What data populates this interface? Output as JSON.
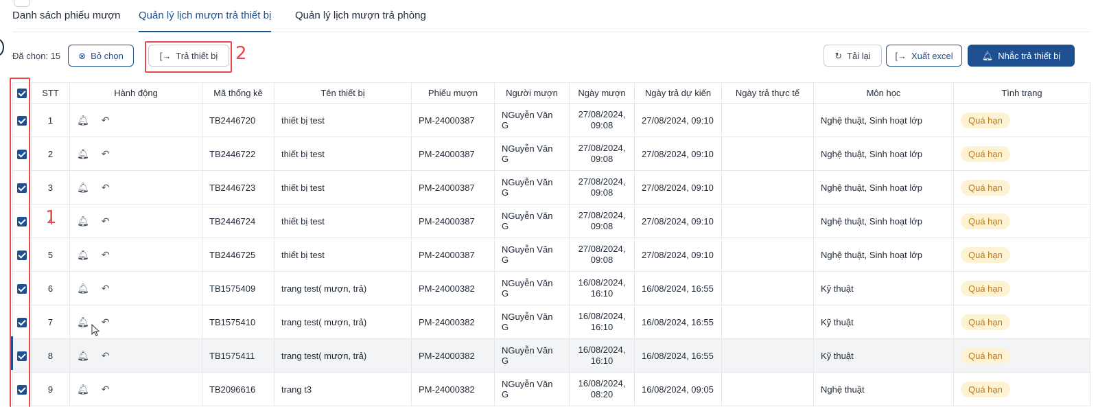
{
  "tabs": [
    {
      "label": "Danh sách phiếu mượn",
      "active": false
    },
    {
      "label": "Quản lý lịch mượn trả thiết bị",
      "active": true
    },
    {
      "label": "Quản lý lịch mượn trả phòng",
      "active": false
    }
  ],
  "toolbar": {
    "selected_text": "Đã chọn: 15",
    "clear_label": "Bỏ chọn",
    "return_label": "Trả thiết bị",
    "reload_label": "Tải lại",
    "export_label": "Xuất excel",
    "remind_label": "Nhắc trả thiết bị"
  },
  "annotations": {
    "one": "1",
    "two": "2"
  },
  "table": {
    "headers": [
      "STT",
      "Hành động",
      "Mã thống kê",
      "Tên thiết bị",
      "Phiếu mượn",
      "Người mượn",
      "Ngày mượn",
      "Ngày trả dự kiến",
      "Ngày trả thực tế",
      "Môn học",
      "Tình trạng"
    ],
    "rows": [
      {
        "stt": "1",
        "code": "TB2446720",
        "name": "thiết bị test",
        "ticket": "PM-24000387",
        "borrower": "NGuyễn Văn G",
        "borrow_date": "27/08/2024,",
        "borrow_time": "09:08",
        "due": "27/08/2024, 09:10",
        "actual": "",
        "subject": "Nghệ thuật, Sinh hoạt lớp",
        "status": "Quá hạn"
      },
      {
        "stt": "2",
        "code": "TB2446722",
        "name": "thiết bị test",
        "ticket": "PM-24000387",
        "borrower": "NGuyễn Văn G",
        "borrow_date": "27/08/2024,",
        "borrow_time": "09:08",
        "due": "27/08/2024, 09:10",
        "actual": "",
        "subject": "Nghệ thuật, Sinh hoạt lớp",
        "status": "Quá hạn"
      },
      {
        "stt": "3",
        "code": "TB2446723",
        "name": "thiết bị test",
        "ticket": "PM-24000387",
        "borrower": "NGuyễn Văn G",
        "borrow_date": "27/08/2024,",
        "borrow_time": "09:08",
        "due": "27/08/2024, 09:10",
        "actual": "",
        "subject": "Nghệ thuật, Sinh hoạt lớp",
        "status": "Quá hạn"
      },
      {
        "stt": "4",
        "code": "TB2446724",
        "name": "thiết bị test",
        "ticket": "PM-24000387",
        "borrower": "NGuyễn Văn G",
        "borrow_date": "27/08/2024,",
        "borrow_time": "09:08",
        "due": "27/08/2024, 09:10",
        "actual": "",
        "subject": "Nghệ thuật, Sinh hoạt lớp",
        "status": "Quá hạn"
      },
      {
        "stt": "5",
        "code": "TB2446725",
        "name": "thiết bị test",
        "ticket": "PM-24000387",
        "borrower": "NGuyễn Văn G",
        "borrow_date": "27/08/2024,",
        "borrow_time": "09:08",
        "due": "27/08/2024, 09:10",
        "actual": "",
        "subject": "Nghệ thuật, Sinh hoạt lớp",
        "status": "Quá hạn"
      },
      {
        "stt": "6",
        "code": "TB1575409",
        "name": "trang test( mượn, trả)",
        "ticket": "PM-24000382",
        "borrower": "NGuyễn Văn G",
        "borrow_date": "16/08/2024,",
        "borrow_time": "16:10",
        "due": "16/08/2024, 16:55",
        "actual": "",
        "subject": "Kỹ thuật",
        "status": "Quá hạn"
      },
      {
        "stt": "7",
        "code": "TB1575410",
        "name": "trang test( mượn, trả)",
        "ticket": "PM-24000382",
        "borrower": "NGuyễn Văn G",
        "borrow_date": "16/08/2024,",
        "borrow_time": "16:10",
        "due": "16/08/2024, 16:55",
        "actual": "",
        "subject": "Kỹ thuật",
        "status": "Quá hạn"
      },
      {
        "stt": "8",
        "code": "TB1575411",
        "name": "trang test( mượn, trả)",
        "ticket": "PM-24000382",
        "borrower": "NGuyễn Văn G",
        "borrow_date": "16/08/2024,",
        "borrow_time": "16:10",
        "due": "16/08/2024, 16:55",
        "actual": "",
        "subject": "Kỹ thuật",
        "status": "Quá hạn"
      },
      {
        "stt": "9",
        "code": "TB2096616",
        "name": "trang t3",
        "ticket": "PM-24000382",
        "borrower": "NGuyễn Văn G",
        "borrow_date": "16/08/2024,",
        "borrow_time": "08:20",
        "due": "16/08/2024, 09:05",
        "actual": "",
        "subject": "Nghệ thuật",
        "status": "Quá hạn"
      }
    ]
  },
  "colors": {
    "primary": "#1d4f91",
    "badge_bg": "#fdf2d1",
    "badge_text": "#b7791f",
    "annotation": "#e5484d"
  }
}
